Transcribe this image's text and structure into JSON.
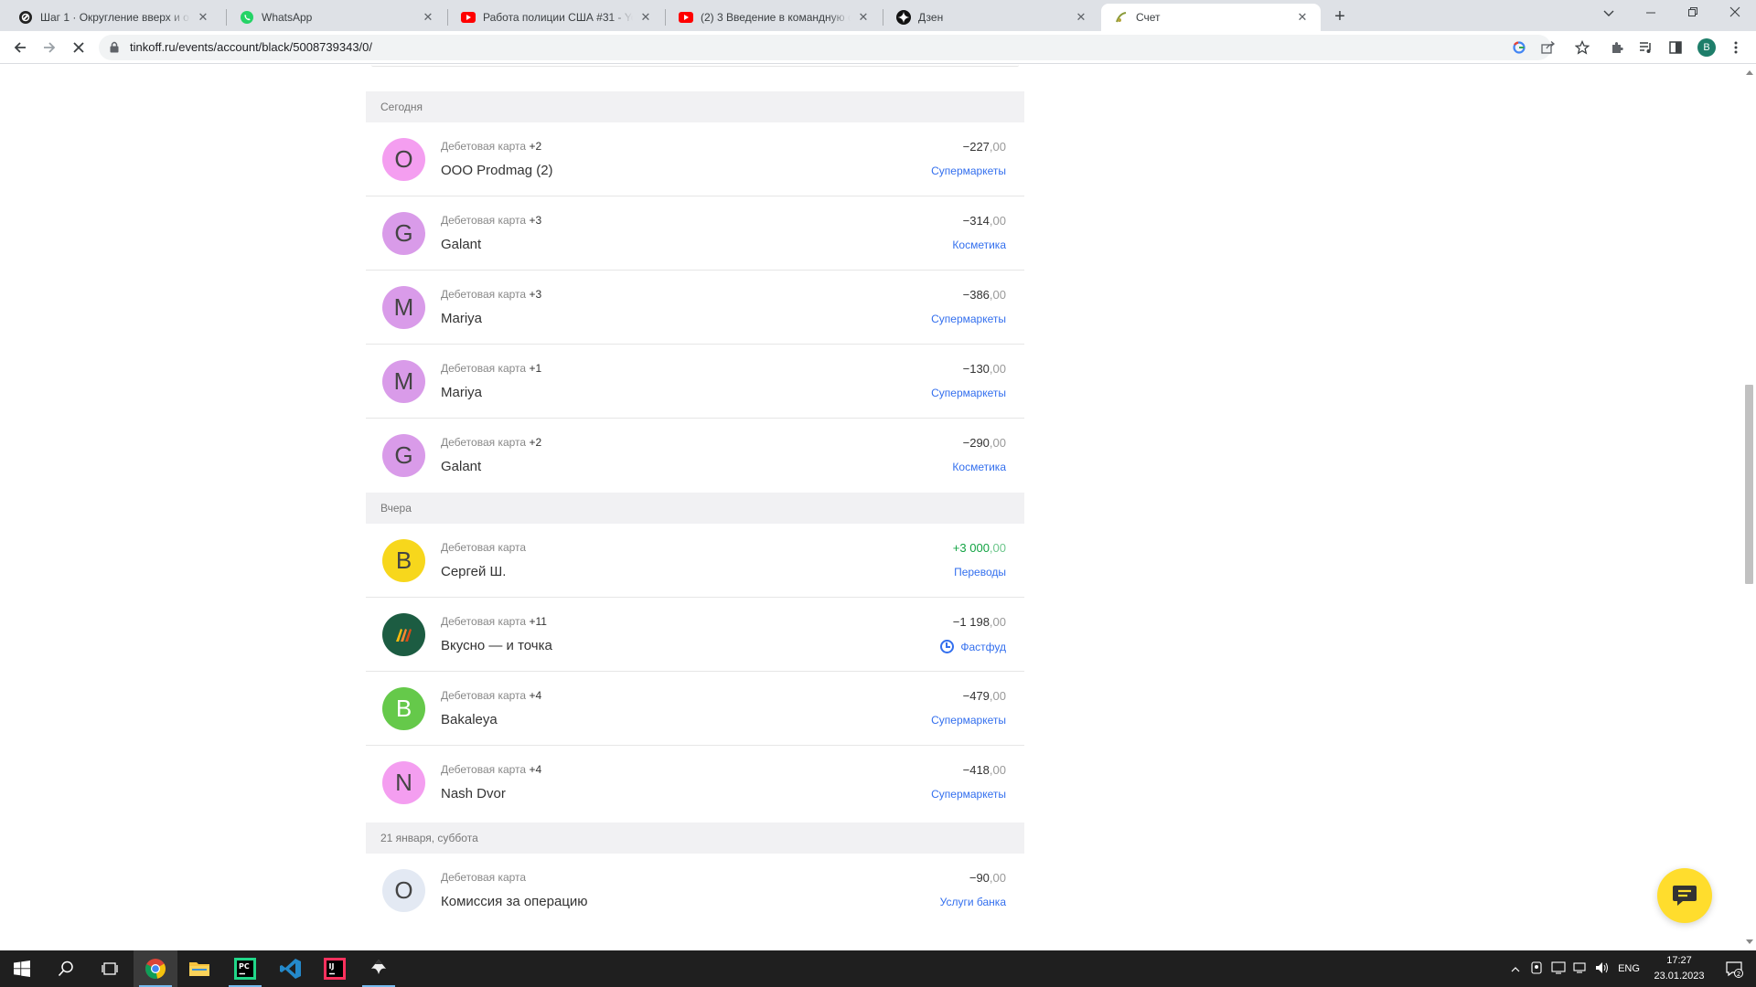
{
  "browser": {
    "tabs": [
      {
        "title": "Шаг 1 · Округление вверх и окр",
        "icon": "stepik-icon"
      },
      {
        "title": "WhatsApp",
        "icon": "whatsapp-icon"
      },
      {
        "title": "Работа полиции США #31 - You",
        "icon": "youtube-icon"
      },
      {
        "title": "(2) 3 Введение в командную стр",
        "icon": "youtube-icon"
      },
      {
        "title": "Дзен",
        "icon": "dzen-icon"
      },
      {
        "title": "Счет",
        "icon": "tinkoff-icon"
      }
    ],
    "close_glyph": "✕",
    "new_tab_glyph": "+",
    "url": "tinkoff.ru/events/account/black/5008739343/0/",
    "profile_initial": "B"
  },
  "feed": {
    "days": [
      {
        "label": "Сегодня",
        "operations": [
          {
            "initial": "O",
            "avatar_color": "#f49ef0",
            "card": "Дебетовая карта",
            "extra": "+2",
            "name": "ООО Prodmag (2)",
            "amount": "−227",
            "kop": ",00",
            "category": "Супермаркеты"
          },
          {
            "initial": "G",
            "avatar_color": "#d99be9",
            "card": "Дебетовая карта",
            "extra": "+3",
            "name": "Galant",
            "amount": "−314",
            "kop": ",00",
            "category": "Косметика"
          },
          {
            "initial": "M",
            "avatar_color": "#d99be9",
            "card": "Дебетовая карта",
            "extra": "+3",
            "name": "Mariya",
            "amount": "−386",
            "kop": ",00",
            "category": "Супермаркеты"
          },
          {
            "initial": "M",
            "avatar_color": "#d99be9",
            "card": "Дебетовая карта",
            "extra": "+1",
            "name": "Mariya",
            "amount": "−130",
            "kop": ",00",
            "category": "Супермаркеты"
          },
          {
            "initial": "G",
            "avatar_color": "#d99be9",
            "card": "Дебетовая карта",
            "extra": "+2",
            "name": "Galant",
            "amount": "−290",
            "kop": ",00",
            "category": "Косметика"
          }
        ]
      },
      {
        "label": "Вчера",
        "operations": [
          {
            "initial": "B",
            "avatar_color": "#f7d71c",
            "card": "Дебетовая карта",
            "extra": "",
            "name": "Сергей Ш.",
            "amount": "+3 000",
            "kop": ",00",
            "category": "Переводы",
            "positive": true
          },
          {
            "initial": "",
            "avatar_color": "#1c5c42",
            "card": "Дебетовая карта",
            "extra": "+11",
            "name": "Вкусно — и точка",
            "amount": "−1 198",
            "kop": ",00",
            "category": "Фастфуд",
            "logo": "vkusno-logo",
            "category_icon": "cashback-icon"
          },
          {
            "initial": "B",
            "avatar_color": "#65c94a",
            "card": "Дебетовая карта",
            "extra": "+4",
            "name": "Bakaleya",
            "amount": "−479",
            "kop": ",00",
            "category": "Супермаркеты",
            "initial_color": "#ffffff"
          },
          {
            "initial": "N",
            "avatar_color": "#f49ef0",
            "card": "Дебетовая карта",
            "extra": "+4",
            "name": "Nash Dvor",
            "amount": "−418",
            "kop": ",00",
            "category": "Супермаркеты"
          }
        ]
      },
      {
        "label": "21 января, суббота",
        "operations": [
          {
            "initial": "O",
            "avatar_color": "#e3e9f3",
            "card": "Дебетовая карта",
            "extra": "",
            "name": "Комиссия за операцию",
            "amount": "−90",
            "kop": ",00",
            "category": "Услуги банка"
          }
        ]
      }
    ]
  },
  "taskbar": {
    "lang": "ENG",
    "time": "17:27",
    "date": "23.01.2023",
    "notifications": "2"
  }
}
